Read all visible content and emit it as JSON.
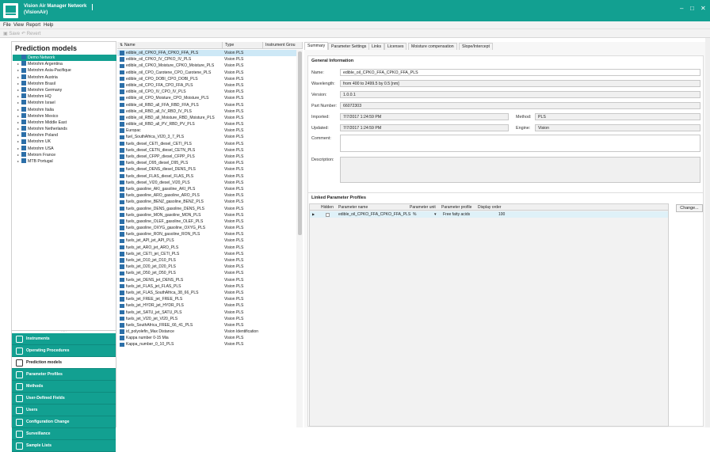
{
  "app": {
    "title_line1": "Vision Air Manager Network",
    "title_line2": "(VisionAir)",
    "window_controls": {
      "minimize": "–",
      "maximize": "□",
      "close": "✕"
    }
  },
  "menu": {
    "items": [
      "File",
      "View",
      "Report",
      "Help"
    ]
  },
  "toolbar": {
    "save_label": "Save",
    "revert_label": "Revert"
  },
  "nav": {
    "header": "Prediction models",
    "tree": [
      {
        "label": "Demo Network",
        "selected": true
      },
      {
        "label": "Metrohm Argentina"
      },
      {
        "label": "Metrohm Asia-Pacifique"
      },
      {
        "label": "Metrohm Austria"
      },
      {
        "label": "Metrohm Brasil"
      },
      {
        "label": "Metrohm Germany"
      },
      {
        "label": "Metrohm HQ"
      },
      {
        "label": "Metrohm Israel"
      },
      {
        "label": "Metrohm Italia"
      },
      {
        "label": "Metrohm Mexico"
      },
      {
        "label": "Metrohm Middle East"
      },
      {
        "label": "Metrohm Netherlands"
      },
      {
        "label": "Metrohm Poland"
      },
      {
        "label": "Metrohm UK"
      },
      {
        "label": "Metrohm USA"
      },
      {
        "label": "Metrom France"
      },
      {
        "label": "MTB Portugal"
      }
    ],
    "splitter_grip": "·····",
    "buttons": [
      {
        "label": "Instruments",
        "icon": "instruments-icon"
      },
      {
        "label": "Operating Procedures",
        "icon": "operating-procedures-icon"
      },
      {
        "label": "Prediction models",
        "icon": "prediction-models-icon",
        "active": true
      },
      {
        "label": "Parameter Profiles",
        "icon": "parameter-profiles-icon"
      },
      {
        "label": "Methods",
        "icon": "methods-icon"
      },
      {
        "label": "User-Defined Fields",
        "icon": "user-defined-fields-icon"
      },
      {
        "label": "Users",
        "icon": "users-icon"
      },
      {
        "label": "Configuration Change",
        "icon": "configuration-change-icon"
      },
      {
        "label": "Surveillance",
        "icon": "surveillance-icon"
      },
      {
        "label": "Sample Lists",
        "icon": "sample-lists-icon"
      }
    ]
  },
  "list": {
    "columns": [
      "Name",
      "Type",
      "Instrument Grou"
    ],
    "rows": [
      {
        "name": "edible_oil_CPKO_FFA_CPKO_FFA_PLS",
        "type": "Vision PLS",
        "selected": true
      },
      {
        "name": "edible_oil_CPKO_IV_CPKO_IV_PLS",
        "type": "Vision PLS"
      },
      {
        "name": "edible_oil_CPKO_Moisture_CPKO_Moisture_PLS",
        "type": "Vision PLS"
      },
      {
        "name": "edible_oil_CPO_Carotene_CPO_Carotene_PLS",
        "type": "Vision PLS"
      },
      {
        "name": "edible_oil_CPO_DOBI_CPO_DOBI_PLS",
        "type": "Vision PLS"
      },
      {
        "name": "edible_oil_CPO_FFA_CPO_FFA_PLS",
        "type": "Vision PLS"
      },
      {
        "name": "edible_oil_CPO_IV_CPO_IV_PLS",
        "type": "Vision PLS"
      },
      {
        "name": "edible_oil_CPO_Moisture_CPO_Moisture_PLS",
        "type": "Vision PLS"
      },
      {
        "name": "edible_oil_RBD_all_FFA_RBD_FFA_PLS",
        "type": "Vision PLS"
      },
      {
        "name": "edible_oil_RBD_all_IV_RBD_IV_PLS",
        "type": "Vision PLS"
      },
      {
        "name": "edible_oil_RBD_all_Moisture_RBD_Moisture_PLS",
        "type": "Vision PLS"
      },
      {
        "name": "edible_oil_RBD_all_PV_RBD_PV_PLS",
        "type": "Vision PLS"
      },
      {
        "name": "Europac",
        "type": "Vision PLS"
      },
      {
        "name": "fuel_SouthAfrica_VI20_3_7_PLS",
        "type": "Vision PLS"
      },
      {
        "name": "fuels_diesel_CETI_diesel_CETI_PLS",
        "type": "Vision PLS"
      },
      {
        "name": "fuels_diesel_CETN_diesel_CETN_PLS",
        "type": "Vision PLS"
      },
      {
        "name": "fuels_diesel_CFPP_diesel_CFPP_PLS",
        "type": "Vision PLS"
      },
      {
        "name": "fuels_diesel_D95_diesel_D95_PLS",
        "type": "Vision PLS"
      },
      {
        "name": "fuels_diesel_DENS_diesel_DENS_PLS",
        "type": "Vision PLS"
      },
      {
        "name": "fuels_diesel_FLAS_diesel_FLAS_PLS",
        "type": "Vision PLS"
      },
      {
        "name": "fuels_diesel_VI20_diesel_VI20_PLS",
        "type": "Vision PLS"
      },
      {
        "name": "fuels_gasoline_AKI_gasoline_AKI_PLS",
        "type": "Vision PLS"
      },
      {
        "name": "fuels_gasoline_ARO_gasoline_ARO_PLS",
        "type": "Vision PLS"
      },
      {
        "name": "fuels_gasoline_BENZ_gasoline_BENZ_PLS",
        "type": "Vision PLS"
      },
      {
        "name": "fuels_gasoline_DENS_gasoline_DENS_PLS",
        "type": "Vision PLS"
      },
      {
        "name": "fuels_gasoline_MON_gasoline_MON_PLS",
        "type": "Vision PLS"
      },
      {
        "name": "fuels_gasoline_OLEF_gasoline_OLEF_PLS",
        "type": "Vision PLS"
      },
      {
        "name": "fuels_gasoline_OXYG_gasoline_OXYG_PLS",
        "type": "Vision PLS"
      },
      {
        "name": "fuels_gasoline_RON_gasoline_RON_PLS",
        "type": "Vision PLS"
      },
      {
        "name": "fuels_jet_API_jet_API_PLS",
        "type": "Vision PLS"
      },
      {
        "name": "fuels_jet_ARO_jet_ARO_PLS",
        "type": "Vision PLS"
      },
      {
        "name": "fuels_jet_CETI_jet_CETI_PLS",
        "type": "Vision PLS"
      },
      {
        "name": "fuels_jet_D10_jet_D10_PLS",
        "type": "Vision PLS"
      },
      {
        "name": "fuels_jet_D20_jet_D20_PLS",
        "type": "Vision PLS"
      },
      {
        "name": "fuels_jet_D50_jet_D50_PLS",
        "type": "Vision PLS"
      },
      {
        "name": "fuels_jet_DENS_jet_DENS_PLS",
        "type": "Vision PLS"
      },
      {
        "name": "fuels_jet_FLAS_jet_FLAS_PLS",
        "type": "Vision PLS"
      },
      {
        "name": "fuels_jet_FLAS_SouthAfrica_38_66_PLS",
        "type": "Vision PLS"
      },
      {
        "name": "fuels_jet_FREE_jet_FREE_PLS",
        "type": "Vision PLS"
      },
      {
        "name": "fuels_jet_HYDR_jet_HYDR_PLS",
        "type": "Vision PLS"
      },
      {
        "name": "fuels_jet_SATU_jet_SATU_PLS",
        "type": "Vision PLS"
      },
      {
        "name": "fuels_jet_VI20_jet_VI20_PLS",
        "type": "Vision PLS"
      },
      {
        "name": "fuels_SouthAfrica_FREE_66_41_PLS",
        "type": "Vision PLS"
      },
      {
        "name": "id_polyolefin_Max Distance",
        "type": "Vision Identification"
      },
      {
        "name": "Kappa number 0-15 Mia",
        "type": "Vision PLS"
      },
      {
        "name": "Kappa_number_0_10_PLS",
        "type": "Vision PLS"
      }
    ]
  },
  "detail": {
    "tabs": [
      "Summary",
      "Parameter Settings",
      "Links",
      "Licenses",
      "Moisture compensation",
      "Slope/Intercept"
    ],
    "active_tab": 0,
    "general": {
      "title": "General Information",
      "name_label": "Name:",
      "name_value": "edible_oil_CPKO_FFA_CPKO_FFA_PLS",
      "wavelength_label": "Wavelength:",
      "wavelength_value": "from 400 to 2499.5 by 0.5 [nm]",
      "version_label": "Version:",
      "version_value": "1.0.0.1",
      "part_label": "Part Number:",
      "part_value": "66072303",
      "imported_label": "Imported:",
      "imported_value": "7/7/2017 1:24:59 PM",
      "method_label": "Method:",
      "method_value": "PLS",
      "updated_label": "Updated:",
      "updated_value": "7/7/2017 1:24:59 PM",
      "engine_label": "Engine:",
      "engine_value": "Vision",
      "comment_label": "Comment:",
      "comment_value": "",
      "description_label": "Description:",
      "description_value": ""
    },
    "linked": {
      "title": "Linked Parameter Profiles",
      "columns": [
        "Hidden",
        "Parameter name",
        "Parameter unit",
        "Parameter profile",
        "Display order"
      ],
      "row": {
        "hidden": false,
        "name": "edible_oil_CPKO_FFA_CPKO_FFA_PLS",
        "unit": "%",
        "profile": "Free fatty acids",
        "order": "100"
      },
      "row_marker": "▶",
      "dropdown_arrow": "▾",
      "change_label": "Change..."
    }
  }
}
